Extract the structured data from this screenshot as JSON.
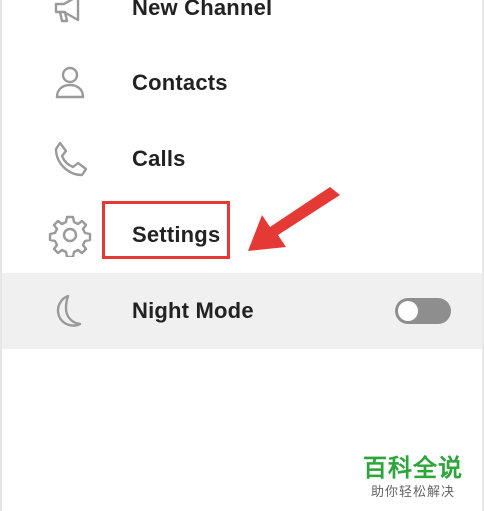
{
  "menu": {
    "items": [
      {
        "label": "New Channel",
        "icon": "megaphone-icon"
      },
      {
        "label": "Contacts",
        "icon": "person-icon"
      },
      {
        "label": "Calls",
        "icon": "phone-icon"
      },
      {
        "label": "Settings",
        "icon": "gear-icon"
      },
      {
        "label": "Night Mode",
        "icon": "moon-icon",
        "toggle": "off"
      }
    ]
  },
  "annotation": {
    "highlight_target": "Settings",
    "highlight_color": "#e53935",
    "arrow_color": "#e53935"
  },
  "watermark": {
    "title": "百科全说",
    "subtitle": "助你轻松解决",
    "color": "#2ca53a"
  },
  "colors": {
    "icon": "#9a9a9a",
    "label": "#222222",
    "hover_row": "#f0f0f0",
    "toggle_off": "#8e8e8e"
  }
}
